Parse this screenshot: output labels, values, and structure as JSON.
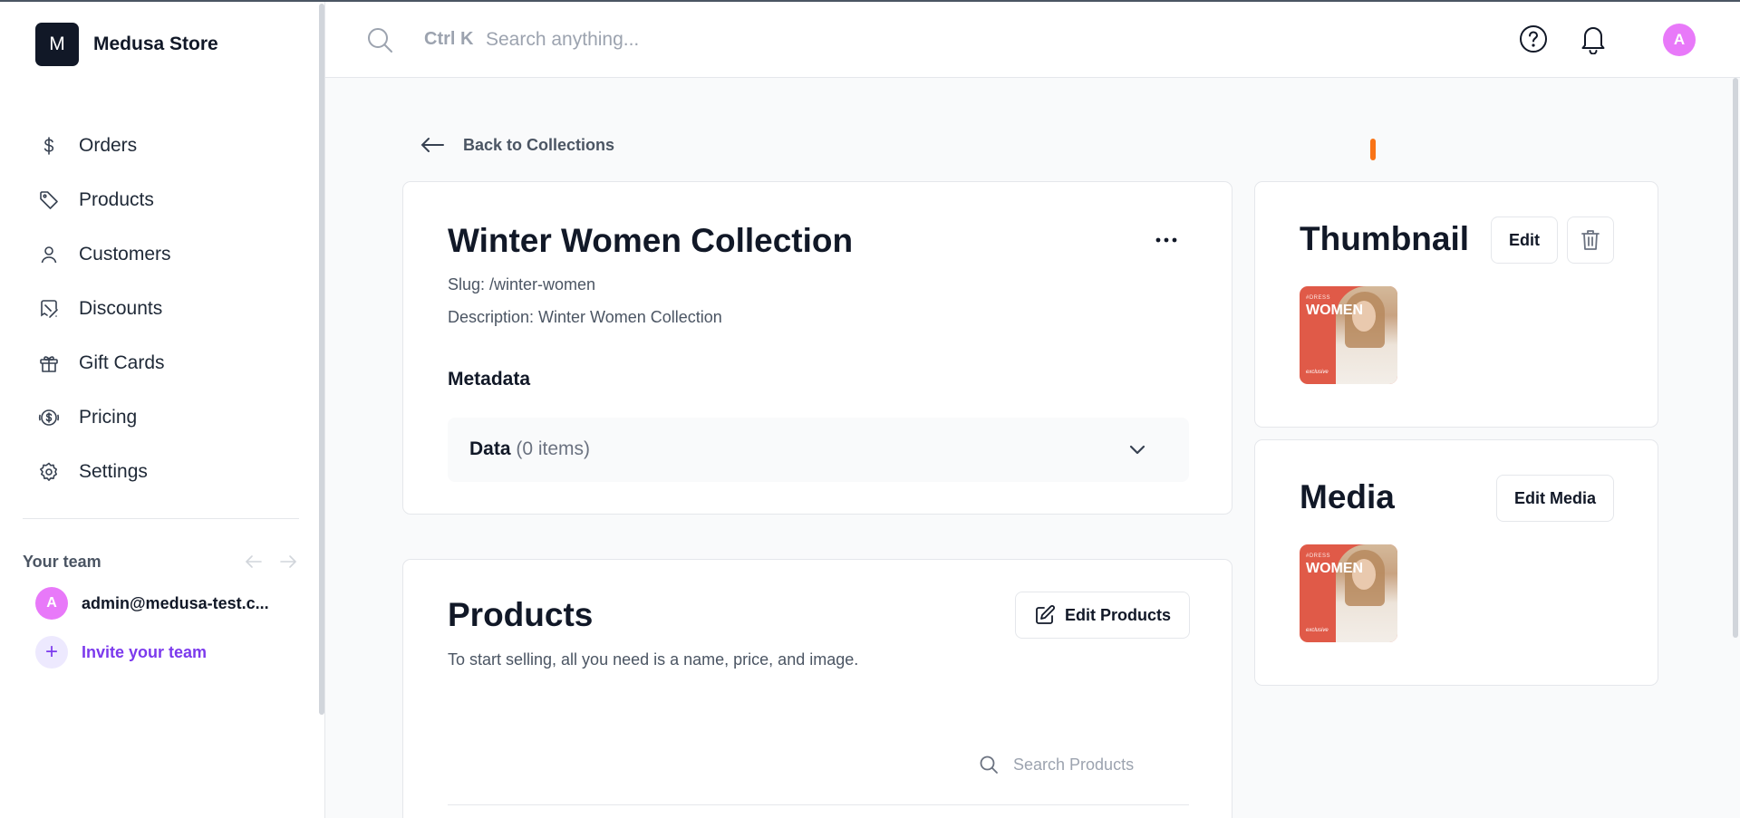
{
  "store": {
    "logo_letter": "M",
    "name": "Medusa Store"
  },
  "nav": {
    "items": [
      {
        "label": "Orders",
        "icon": "dollar-icon"
      },
      {
        "label": "Products",
        "icon": "tag-icon"
      },
      {
        "label": "Customers",
        "icon": "user-icon"
      },
      {
        "label": "Discounts",
        "icon": "receipt-percent-icon"
      },
      {
        "label": "Gift Cards",
        "icon": "gift-icon"
      },
      {
        "label": "Pricing",
        "icon": "coin-icon"
      },
      {
        "label": "Settings",
        "icon": "gear-icon"
      }
    ]
  },
  "team": {
    "title": "Your team",
    "user_initial": "A",
    "user_email": "admin@medusa-test.c...",
    "invite_label": "Invite your team"
  },
  "topbar": {
    "shortcut": "Ctrl K",
    "search_placeholder": "Search anything...",
    "avatar_initial": "A"
  },
  "back": {
    "label": "Back to Collections"
  },
  "collection": {
    "title": "Winter Women Collection",
    "slug": "Slug: /winter-women",
    "description": "Description: Winter Women Collection",
    "metadata_title": "Metadata",
    "data_label": "Data",
    "data_count": "(0 items)"
  },
  "products": {
    "title": "Products",
    "subtitle": "To start selling, all you need is a name, price, and image.",
    "edit_label": "Edit Products",
    "search_placeholder": "Search Products"
  },
  "thumbnail": {
    "title": "Thumbnail",
    "edit_label": "Edit",
    "image": {
      "tag": "#DRESS",
      "word": "WOMEN",
      "small": "exclusive"
    }
  },
  "media": {
    "title": "Media",
    "edit_label": "Edit Media",
    "image": {
      "tag": "#DRESS",
      "word": "WOMEN",
      "small": "exclusive"
    }
  },
  "colors": {
    "accent": "#7C3AED",
    "avatar": "#E879F9",
    "indicator": "#F97316"
  }
}
